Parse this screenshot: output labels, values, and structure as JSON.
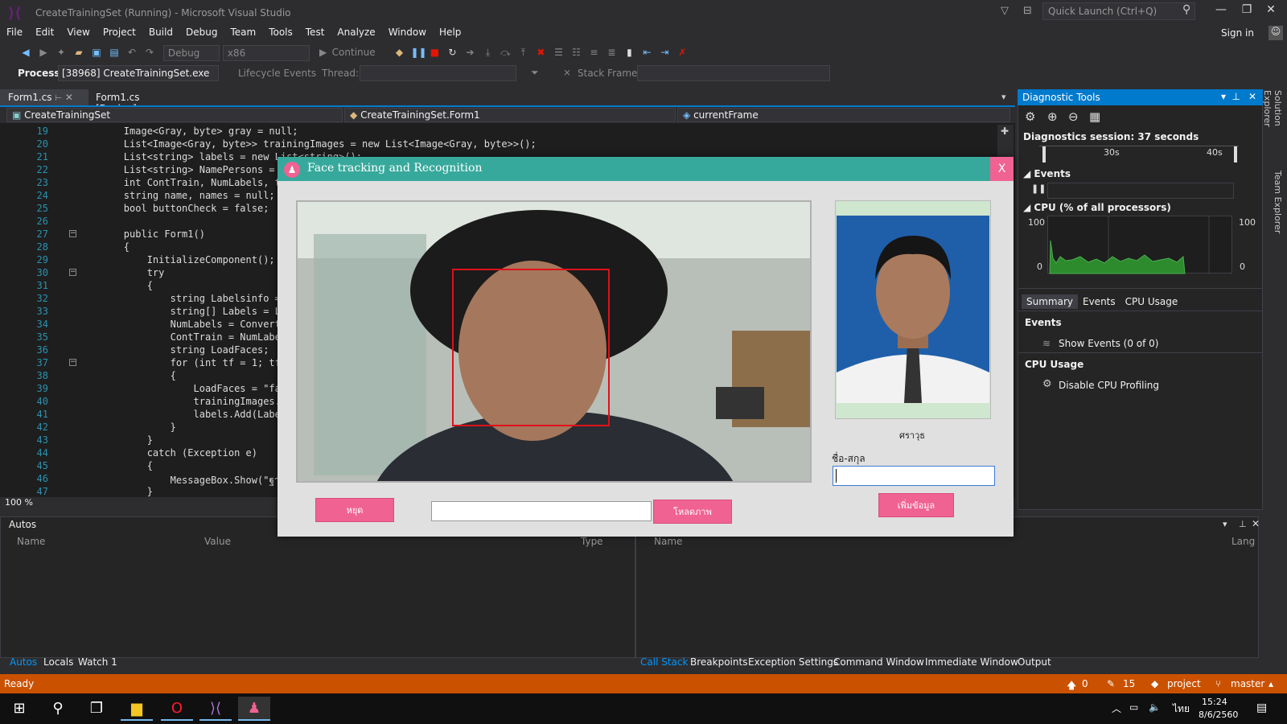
{
  "window": {
    "title": "CreateTrainingSet (Running) - Microsoft Visual Studio",
    "quick_launch_placeholder": "Quick Launch (Ctrl+Q)",
    "sign_in": "Sign in"
  },
  "menu": [
    "File",
    "Edit",
    "View",
    "Project",
    "Build",
    "Debug",
    "Team",
    "Tools",
    "Test",
    "Analyze",
    "Window",
    "Help"
  ],
  "toolbar": {
    "config": "Debug",
    "platform": "x86",
    "continue": "Continue"
  },
  "debugbar": {
    "process_label": "Process:",
    "process_value": "[38968] CreateTrainingSet.exe",
    "lifecycle": "Lifecycle Events",
    "thread_label": "Thread:",
    "stack_label": "Stack Frame:"
  },
  "tabs": {
    "active": "Form1.cs",
    "design": "Form1.cs [Design]"
  },
  "navbar": {
    "project": "CreateTrainingSet",
    "class": "CreateTrainingSet.Form1",
    "member": "currentFrame"
  },
  "code": {
    "lines": [
      {
        "n": "19",
        "t": "        Image<Gray, byte> gray = null;"
      },
      {
        "n": "20",
        "t": "        List<Image<Gray, byte>> trainingImages = new List<Image<Gray, byte>>();"
      },
      {
        "n": "21",
        "t": "        List<string> labels = new List<string>();"
      },
      {
        "n": "22",
        "t": "        List<string> NamePersons ="
      },
      {
        "n": "23",
        "t": "        int ContTrain, NumLabels, t"
      },
      {
        "n": "24",
        "t": "        string name, names = null;"
      },
      {
        "n": "25",
        "t": "        bool buttonCheck = false;"
      },
      {
        "n": "26",
        "t": ""
      },
      {
        "n": "27",
        "t": "        public Form1()"
      },
      {
        "n": "28",
        "t": "        {"
      },
      {
        "n": "29",
        "t": "            InitializeComponent();"
      },
      {
        "n": "30",
        "t": "            try"
      },
      {
        "n": "31",
        "t": "            {"
      },
      {
        "n": "32",
        "t": "                string Labelsinfo ="
      },
      {
        "n": "33",
        "t": "                string[] Labels = L"
      },
      {
        "n": "34",
        "t": "                NumLabels = Convert"
      },
      {
        "n": "35",
        "t": "                ContTrain = NumLabe"
      },
      {
        "n": "36",
        "t": "                string LoadFaces;"
      },
      {
        "n": "37",
        "t": "                for (int tf = 1; tf"
      },
      {
        "n": "38",
        "t": "                {"
      },
      {
        "n": "39",
        "t": "                    LoadFaces = \"fa"
      },
      {
        "n": "40",
        "t": "                    trainingImages."
      },
      {
        "n": "41",
        "t": "                    labels.Add(Labe"
      },
      {
        "n": "42",
        "t": "                }"
      },
      {
        "n": "43",
        "t": "            }"
      },
      {
        "n": "44",
        "t": "            catch (Exception e)"
      },
      {
        "n": "45",
        "t": "            {"
      },
      {
        "n": "46",
        "t": "                MessageBox.Show(\"ฐา"
      },
      {
        "n": "47",
        "t": "            }"
      }
    ],
    "zoom": "100 %"
  },
  "diag": {
    "title": "Diagnostic Tools",
    "session": "Diagnostics session: 37 seconds",
    "tick_30": "30s",
    "tick_40": "40s",
    "events_section": "Events",
    "cpu_section": "CPU (% of all processors)",
    "cpu_max_l": "100",
    "cpu_min_l": "0",
    "cpu_max_r": "100",
    "cpu_min_r": "0",
    "tabs": [
      "Summary",
      "Events",
      "CPU Usage"
    ],
    "events_header": "Events",
    "show_events": "Show Events (0 of 0)",
    "cpu_header": "CPU Usage",
    "disable_cpu": "Disable CPU Profiling"
  },
  "side_tabs": {
    "solution": "Solution Explorer",
    "team": "Team Explorer"
  },
  "autos": {
    "title": "Autos",
    "cols": [
      "Name",
      "Value",
      "Type"
    ],
    "tabs": [
      "Autos",
      "Locals",
      "Watch 1"
    ]
  },
  "callstack": {
    "cols": [
      "Name",
      "Lang"
    ],
    "tabs": [
      "Call Stack",
      "Breakpoints",
      "Exception Settings",
      "Command Window",
      "Immediate Window",
      "Output"
    ]
  },
  "status": {
    "ready": "Ready",
    "up": "0",
    "edits": "15",
    "project": "project",
    "branch": "master"
  },
  "taskbar": {
    "time": "15:24",
    "date": "8/6/2560",
    "lang": "ไทย"
  },
  "dialog": {
    "title": "Face tracking and Recognition",
    "close": "X",
    "profile_name": "ศราวุธ",
    "fullname_label": "ชื่อ-สกุล",
    "stop_button": "หยุด",
    "load_button": "โหลดภาพ",
    "add_button": "เพิ่มข้อมูล"
  },
  "colors": {
    "accent": "#007acc",
    "status": "#ca5100",
    "dialog_title": "#37a99c",
    "pink": "#f06292",
    "face_box": "#e0101a"
  }
}
